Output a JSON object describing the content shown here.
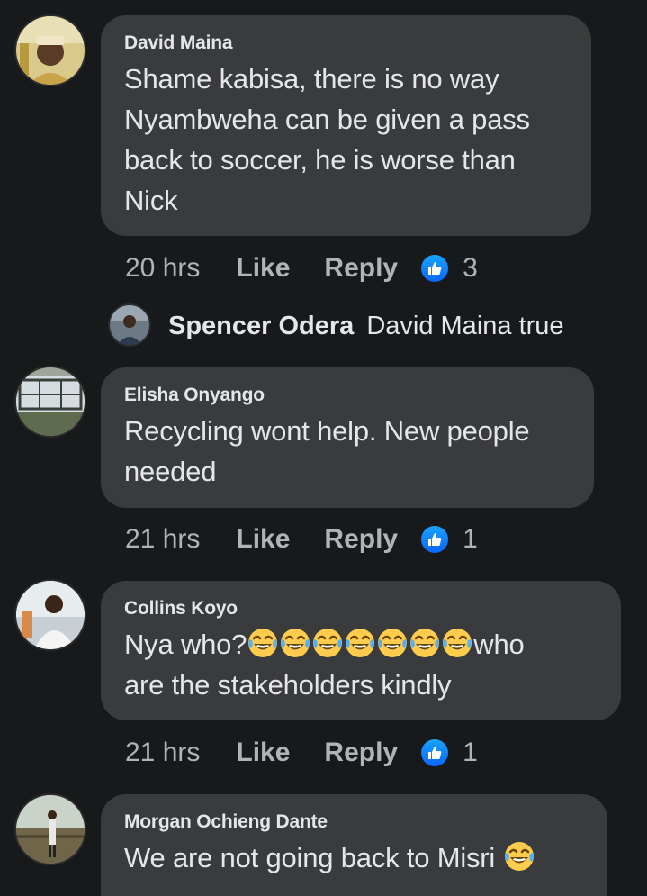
{
  "comments": [
    {
      "author": "David Maina",
      "lines": [
        "Shame kabisa, there is no way",
        "Nyambweha can be given a pass",
        "back to soccer, he is worse than",
        "Nick"
      ],
      "time": "20 hrs",
      "like_label": "Like",
      "reply_label": "Reply",
      "reactions": "3"
    },
    {
      "author": "Elisha Onyango",
      "lines": [
        "Recycling wont help. New people",
        "needed"
      ],
      "time": "21 hrs",
      "like_label": "Like",
      "reply_label": "Reply",
      "reactions": "1"
    },
    {
      "author": "Collins Koyo",
      "line1_prefix": "Nya who?",
      "line1_suffix": "who",
      "line2": "are the stakeholders kindly",
      "time": "21 hrs",
      "like_label": "Like",
      "reply_label": "Reply",
      "reactions": "1"
    },
    {
      "author": "Morgan Ochieng Dante",
      "text": "We are not going back to Misri"
    }
  ],
  "reply": {
    "author": "Spencer Odera",
    "text": "David Maina true"
  },
  "colors": {
    "background": "#18191a",
    "bubble": "#3a3b3c",
    "text": "#e4e6eb",
    "secondary": "#b0b3b8",
    "like_blue": "#0866ff"
  }
}
